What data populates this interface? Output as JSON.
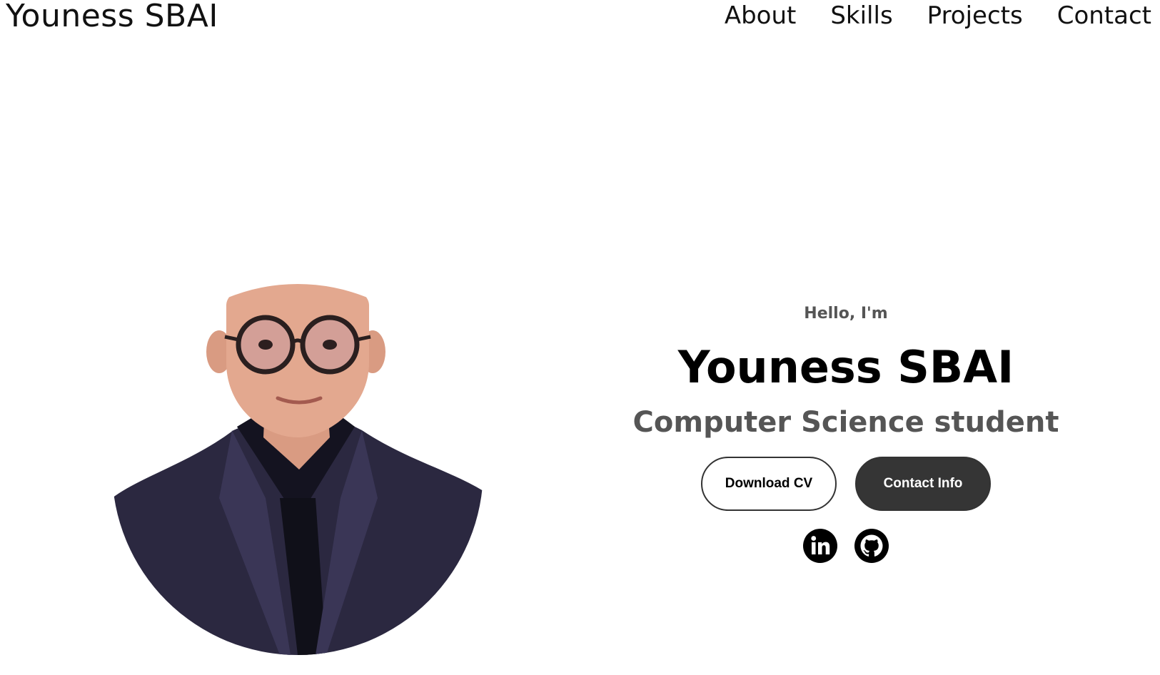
{
  "nav": {
    "logo": "Youness SBAI",
    "links": [
      "About",
      "Skills",
      "Projects",
      "Contact"
    ]
  },
  "hero": {
    "greeting": "Hello, I'm",
    "name": "Youness SBAI",
    "role": "Computer Science student",
    "buttons": {
      "download_cv": "Download CV",
      "contact_info": "Contact Info"
    },
    "socials": [
      "linkedin-icon",
      "github-icon"
    ]
  },
  "profile": {
    "alt": "Youness SBAI profile picture"
  },
  "colors": {
    "text": "#000000",
    "muted": "#555555",
    "button_dark": "#353535",
    "background": "#ffffff"
  }
}
